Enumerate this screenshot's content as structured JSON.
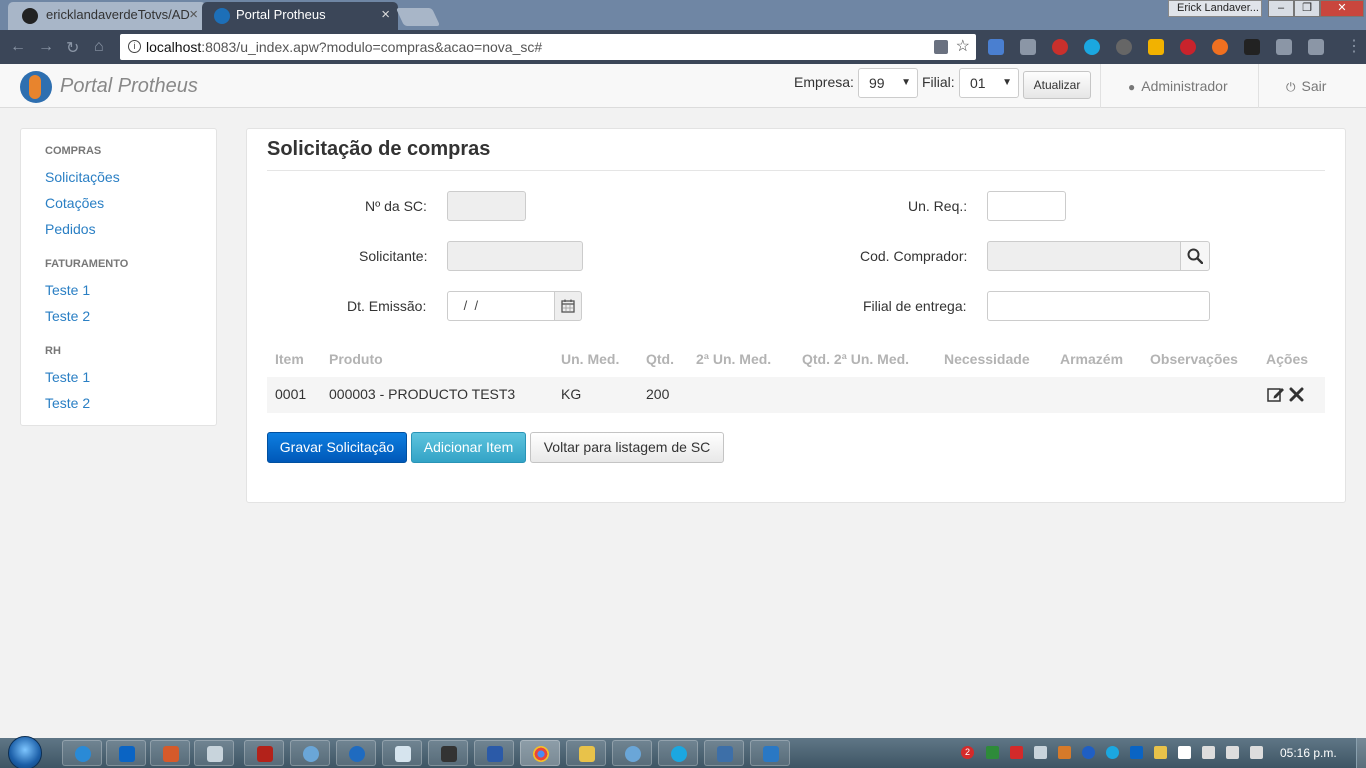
{
  "browser": {
    "tabs": [
      {
        "title": "ericklandaverdeTotvs/AD",
        "active": false
      },
      {
        "title": "Portal Protheus",
        "active": true
      }
    ],
    "profile_name": "Erick Landaver...",
    "window_controls": {
      "minimize": "–",
      "maximize": "❐",
      "close": "✕"
    },
    "url_host": "localhost",
    "url_rest": ":8083/u_index.apw?modulo=compras&acao=nova_sc#"
  },
  "header": {
    "brand": "Portal Protheus",
    "empresa_label": "Empresa:",
    "empresa_value": "99",
    "filial_label": "Filial:",
    "filial_value": "01",
    "refresh_label": "Atualizar",
    "user_label": "Administrador",
    "logout_label": "Sair"
  },
  "sidebar": {
    "sections": [
      {
        "title": "COMPRAS",
        "items": [
          "Solicitações",
          "Cotações",
          "Pedidos"
        ]
      },
      {
        "title": "FATURAMENTO",
        "items": [
          "Teste 1",
          "Teste 2"
        ]
      },
      {
        "title": "RH",
        "items": [
          "Teste 1",
          "Teste 2"
        ]
      }
    ]
  },
  "form": {
    "title": "Solicitação de compras",
    "fields": {
      "nsc_label": "Nº da SC:",
      "nsc_value": "",
      "unreq_label": "Un. Req.:",
      "unreq_value": "",
      "solicitante_label": "Solicitante:",
      "solicitante_value": "",
      "comprador_label": "Cod. Comprador:",
      "comprador_value": "",
      "emissao_label": "Dt. Emissão:",
      "emissao_value": " /  /",
      "filial_entrega_label": "Filial de entrega:",
      "filial_entrega_value": ""
    }
  },
  "table": {
    "columns": [
      "Item",
      "Produto",
      "Un. Med.",
      "Qtd.",
      "2ª Un. Med.",
      "Qtd. 2ª Un. Med.",
      "Necessidade",
      "Armazém",
      "Observações",
      "Ações"
    ],
    "rows": [
      {
        "item": "0001",
        "produto": "000003 - PRODUCTO TEST3",
        "un_med": "KG",
        "qtd": "200",
        "seg_un_med": "",
        "qtd_seg_un_med": "",
        "necessidade": "",
        "armazem": "",
        "observacoes": ""
      }
    ]
  },
  "actions": {
    "save": "Gravar Solicitação",
    "add_item": "Adicionar Item",
    "back": "Voltar para listagem de SC"
  },
  "taskbar": {
    "clock": "05:16 p.m.",
    "tray_badge": "2"
  },
  "colors": {
    "link": "#2a7fc4",
    "primary": "#0868c8",
    "info": "#46b4d4",
    "tab_active": "#3b4658"
  }
}
